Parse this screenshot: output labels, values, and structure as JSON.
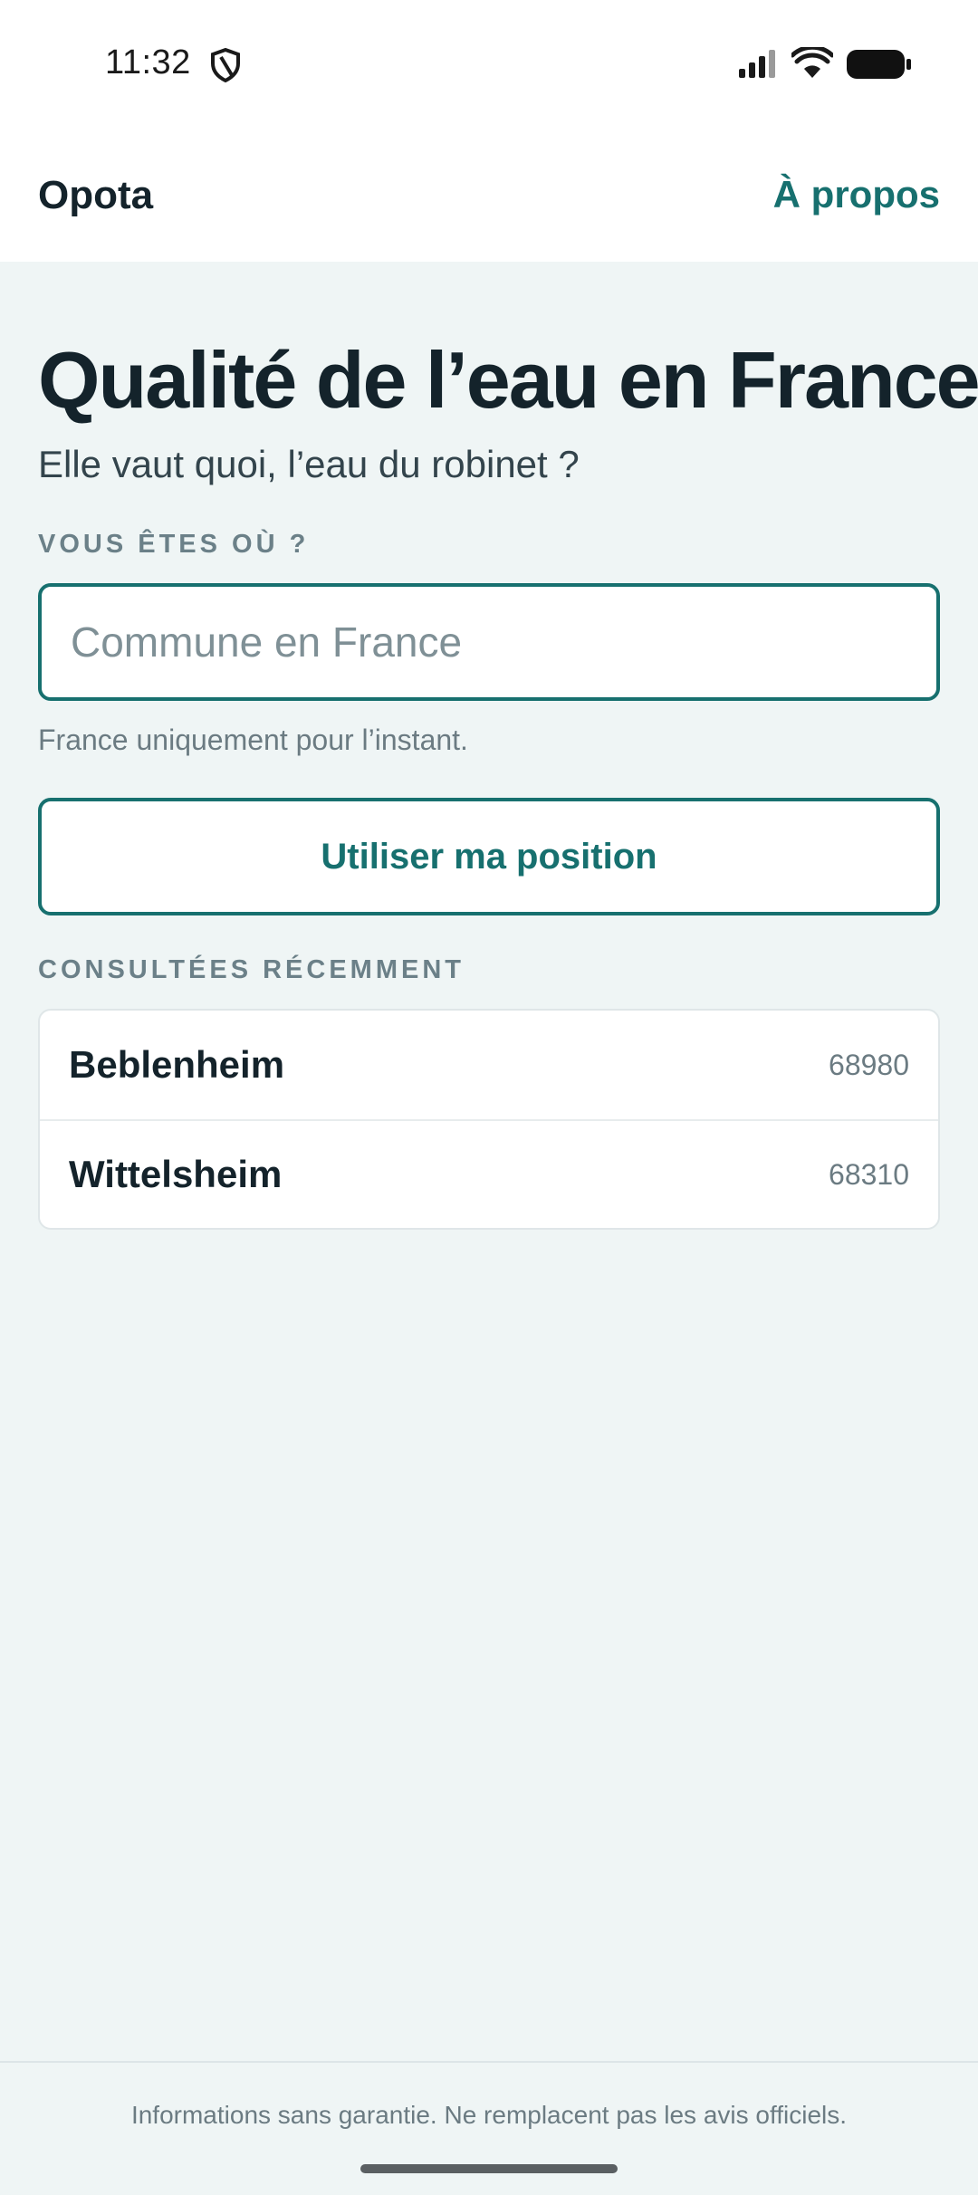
{
  "status_bar": {
    "time": "11:32",
    "icons": [
      "shield-icon",
      "signal-icon",
      "wifi-icon",
      "battery-icon"
    ]
  },
  "header": {
    "title": "Opota",
    "about_link": "À propos"
  },
  "main": {
    "title": "Qualité de l’eau en France",
    "subtitle": "Elle vaut quoi, l’eau du robinet ?",
    "search": {
      "label": "VOUS ÊTES OÙ ?",
      "placeholder": "Commune en France",
      "value": "",
      "helper": "France uniquement pour l’instant."
    },
    "position_button": "Utiliser ma position",
    "recent": {
      "label": "CONSULTÉES RÉCEMMENT",
      "items": [
        {
          "name": "Beblenheim",
          "code": "68980"
        },
        {
          "name": "Wittelsheim",
          "code": "68310"
        }
      ]
    }
  },
  "footer": {
    "disclaimer": "Informations sans garantie. Ne remplacent pas les avis officiels."
  },
  "colors": {
    "accent": "#17706f",
    "background": "#eff5f5",
    "text": "#14232b"
  }
}
